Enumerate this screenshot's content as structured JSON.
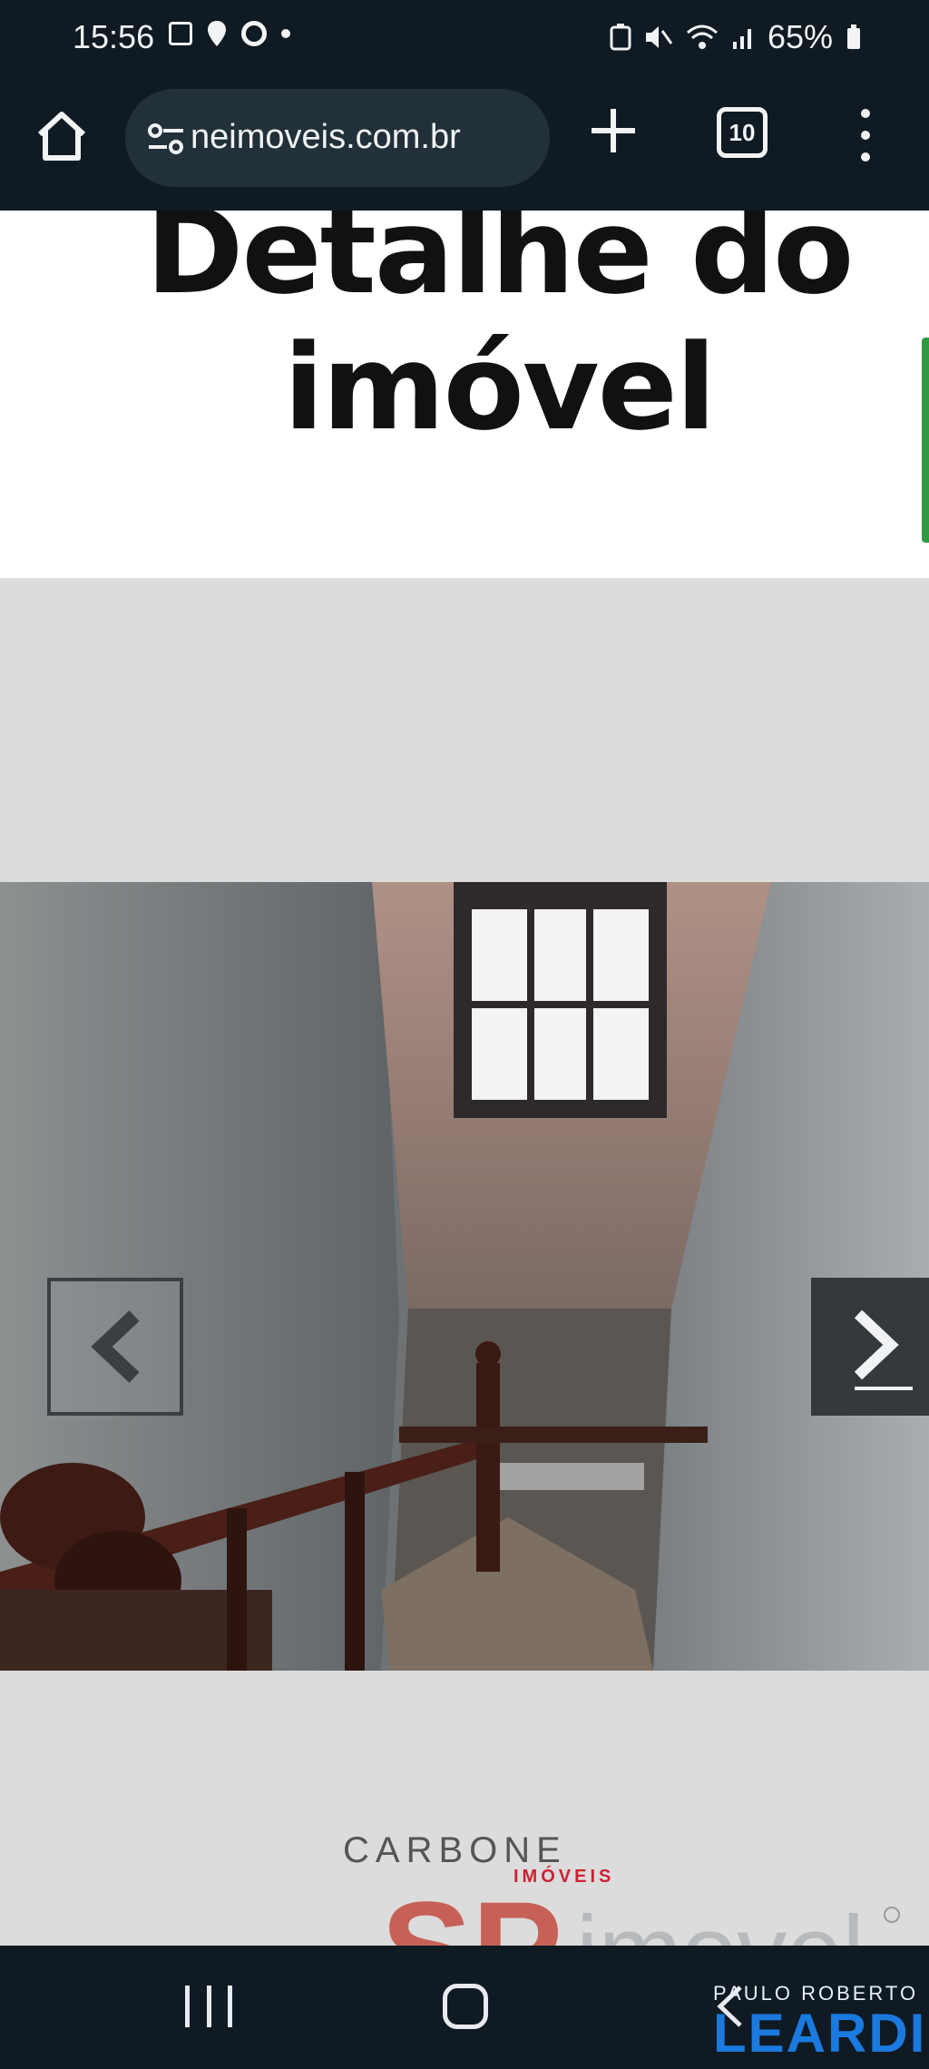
{
  "status_bar": {
    "time": "15:56",
    "battery": "65%",
    "icons": [
      "image-icon",
      "location-icon",
      "chrome-icon",
      "notification-dot-icon",
      "battery-saver-icon",
      "mute-icon",
      "wifi-icon",
      "signal-icon",
      "battery-icon"
    ]
  },
  "browser": {
    "url": "neimoveis.com.br",
    "tab_count": "10",
    "icons": [
      "home-icon",
      "tune-icon",
      "plus-icon",
      "tabs-icon",
      "more-vert-icon"
    ]
  },
  "page": {
    "title_line1": "Detalhe do",
    "title_line2": "imóvel"
  },
  "gallery": {
    "watermark_brand": "CARBONE",
    "watermark_sub": "IMÓVEIS",
    "prev_icon": "chevron-left-icon",
    "next_icon": "chevron-right-icon"
  },
  "logo": {
    "sp_text": "SP",
    "imovel_text": "imovel",
    "byline_small": "PAULO ROBERTO",
    "byline_big": "LEARDI"
  },
  "nav_bar": {
    "icons": [
      "recents-icon",
      "home-nav-icon",
      "back-icon"
    ]
  },
  "colors": {
    "chrome_bg": "#101a22",
    "url_pill": "#213039",
    "page_bg": "#dcdcdc",
    "accent_green": "#2e9b43",
    "leardi_blue": "#1a7ae0",
    "sp_red": "#c0392b"
  }
}
